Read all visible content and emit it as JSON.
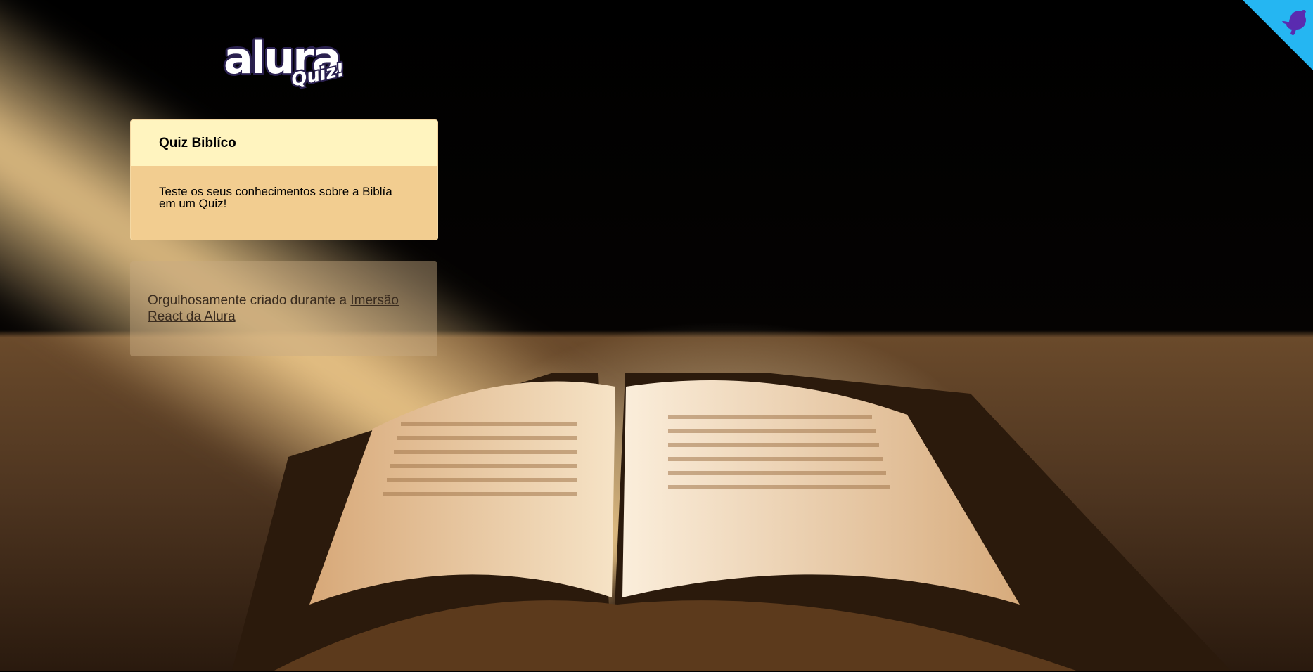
{
  "logo": {
    "main": "alura",
    "sub": "Quiz!"
  },
  "card": {
    "title": "Quiz Biblíco",
    "description": "Teste os seus conhecimentos sobre a Biblía em um Quiz!"
  },
  "footer": {
    "text": "Orgulhosamente criado durante a ",
    "link": "Imersão React da Alura"
  },
  "corner": {
    "icon": "github-octocat-icon",
    "color": "#25b6f2"
  },
  "colors": {
    "card_header": "#fff4bf",
    "card_body": "#f2cd90",
    "logo_outline": "#2b2150"
  }
}
